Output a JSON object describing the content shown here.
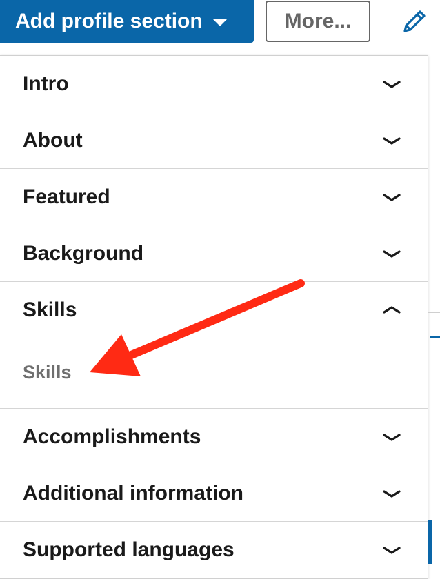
{
  "toolbar": {
    "add_section_label": "Add profile section",
    "more_label": "More...",
    "edit_icon": "pencil-icon"
  },
  "sections": [
    {
      "label": "Intro",
      "state": "collapsed"
    },
    {
      "label": "About",
      "state": "collapsed"
    },
    {
      "label": "Featured",
      "state": "collapsed"
    },
    {
      "label": "Background",
      "state": "collapsed"
    },
    {
      "label": "Skills",
      "state": "expanded",
      "children": [
        {
          "label": "Skills"
        }
      ]
    },
    {
      "label": "Accomplishments",
      "state": "collapsed"
    },
    {
      "label": "Additional information",
      "state": "collapsed"
    },
    {
      "label": "Supported languages",
      "state": "collapsed"
    }
  ],
  "colors": {
    "brand_blue": "#0a66a8",
    "annotation_arrow": "#ff2a14",
    "subitem_gray": "#6f6f6f"
  }
}
